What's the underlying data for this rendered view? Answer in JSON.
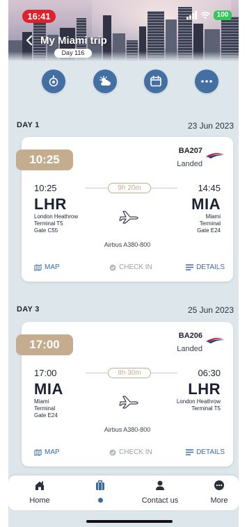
{
  "status_bar": {
    "time": "16:41",
    "battery": "100"
  },
  "header": {
    "title": "My Miami trip",
    "day_badge": "Day 116"
  },
  "quick_actions": [
    {
      "icon": "map-pin-icon"
    },
    {
      "icon": "weather-icon"
    },
    {
      "icon": "calendar-icon"
    },
    {
      "icon": "more-dots-icon"
    }
  ],
  "days": [
    {
      "label": "DAY 1",
      "date": "23 Jun 2023",
      "flight": {
        "time_tag": "10:25",
        "number": "BA207",
        "status": "Landed",
        "dep_time": "10:25",
        "dep_code": "LHR",
        "dep_lines": [
          "London Heathrow",
          "Terminal T5",
          "Gate C55"
        ],
        "duration": "9h 20m",
        "arr_time": "14:45",
        "arr_code": "MIA",
        "arr_lines": [
          "Miami",
          "Terminal",
          "Gate E24"
        ],
        "aircraft": "Airbus A380-800"
      }
    },
    {
      "label": "DAY 3",
      "date": "25 Jun 2023",
      "flight": {
        "time_tag": "17:00",
        "number": "BA206",
        "status": "Landed",
        "dep_time": "17:00",
        "dep_code": "MIA",
        "dep_lines": [
          "Miami",
          "Terminal",
          "Gate E24"
        ],
        "duration": "8h 30m",
        "arr_time": "06:30",
        "arr_code": "LHR",
        "arr_lines": [
          "London Heathrow",
          "Terminal T5",
          ""
        ],
        "aircraft": "Airbus A380-800"
      }
    }
  ],
  "card_actions": {
    "map": "MAP",
    "check_in": "CHECK IN",
    "details": "DETAILS"
  },
  "nav": {
    "home": "Home",
    "contact": "Contact us",
    "more": "More"
  },
  "colors": {
    "accent": "#436fa3",
    "time_tag": "#c4ac8e",
    "status_badge": "#e0202b"
  }
}
